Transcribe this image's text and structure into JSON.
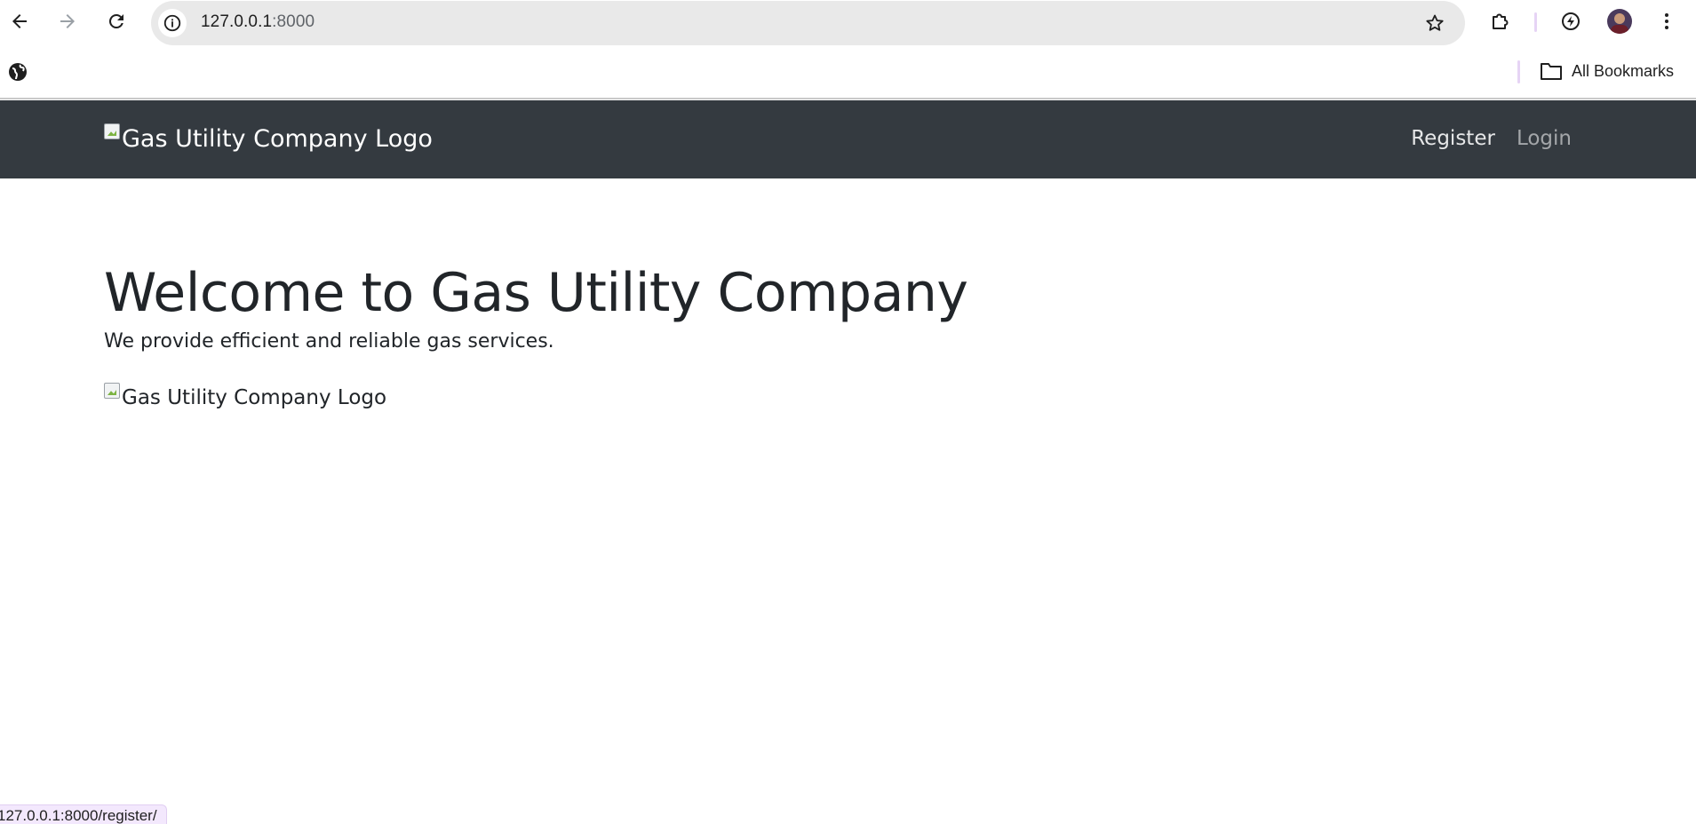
{
  "browser": {
    "url_host": "127.0.0.1",
    "url_port": ":8000",
    "bookmarks_label": "All Bookmarks",
    "status_url": "127.0.0.1:8000/register/"
  },
  "navbar": {
    "logo_alt": "Gas Utility Company Logo",
    "links": [
      {
        "label": "Register"
      },
      {
        "label": "Login"
      }
    ]
  },
  "main": {
    "title": "Welcome to Gas Utility Company",
    "subtitle": "We provide efficient and reliable gas services.",
    "image_alt": "Gas Utility Company Logo"
  },
  "icons": {
    "back": "arrow-left-icon",
    "forward": "arrow-right-icon",
    "reload": "reload-icon",
    "site_info": "info-icon",
    "bookmark_star": "star-icon",
    "extensions": "puzzle-icon",
    "performance": "lightning-icon",
    "profile": "avatar",
    "menu": "kebab-menu-icon",
    "globe": "globe-icon",
    "folder": "folder-icon"
  },
  "colors": {
    "navbar_bg": "#343a40",
    "text": "#212529",
    "omnibox_bg": "#e9e9e9",
    "status_bg": "#f3e8fd"
  }
}
